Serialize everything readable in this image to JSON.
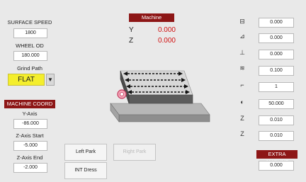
{
  "left": {
    "surface_speed": {
      "label": "SURFACE SPEED",
      "value": "1800"
    },
    "wheel_od": {
      "label": "WHEEL OD",
      "value": "180.000"
    },
    "grind_path": {
      "label": "Grind Path",
      "value": "FLAT",
      "arrow": "▼"
    },
    "machine_coord": {
      "header": "MACHINE COORD",
      "y_axis": {
        "label": "Y-Axis",
        "value": "-86.000"
      },
      "z_start": {
        "label": "Z-Axis Start",
        "value": "-5.000"
      },
      "z_end": {
        "label": "Z-Axis End",
        "value": "-2.000"
      }
    }
  },
  "machine": {
    "header": "Machine",
    "y": {
      "label": "Y",
      "value": "0.000"
    },
    "z": {
      "label": "Z",
      "value": "0.000"
    }
  },
  "buttons": {
    "left_park": "Left Park",
    "right_park": "Right Park",
    "int_dress": "INT Dress"
  },
  "right": {
    "params": [
      {
        "icon": "dress-amount-icon",
        "glyph": "⊟",
        "value": "0.000"
      },
      {
        "icon": "dress-angle-icon",
        "glyph": "⊿",
        "value": "0.000"
      },
      {
        "icon": "dress-down-icon",
        "glyph": "⊥",
        "value": "0.000"
      },
      {
        "icon": "dress-feed-icon",
        "glyph": "≋",
        "value": "0.100"
      },
      {
        "icon": "pass-count-icon",
        "glyph": "⌐",
        "value": "1"
      },
      {
        "icon": "wheel-speed-icon",
        "glyph": "◐",
        "value": "50.000"
      },
      {
        "icon": "z-feed-icon",
        "glyph": "Z",
        "value": "0.010"
      },
      {
        "icon": "z-step-icon",
        "glyph": "Z",
        "value": "0.010"
      }
    ],
    "extra_amount": {
      "header": "EXTRA AMOUNT",
      "value": "0.000"
    }
  },
  "colors": {
    "header_bg": "#8d1616",
    "value_red": "#d10f0f",
    "grind_path_bg": "#f4ee2c"
  }
}
